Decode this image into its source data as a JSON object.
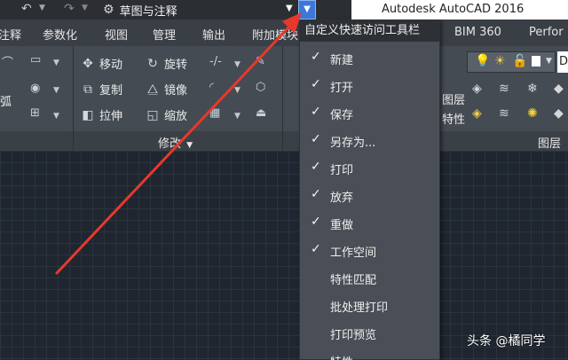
{
  "title_bar": {
    "workspace_name": "草图与注释",
    "app_title": "Autodesk AutoCAD 2016"
  },
  "ribbon_tabs": [
    "注释",
    "参数化",
    "视图",
    "管理",
    "输出",
    "附加模块",
    "BIM 360",
    "Perfor"
  ],
  "modify_panel": {
    "title": "修改",
    "buttons": {
      "move": "移动",
      "rotate": "旋转",
      "copy": "复制",
      "mirror": "镜像",
      "stretch": "拉伸",
      "scale": "缩放"
    }
  },
  "draw_panel": {
    "arc_label": "弧"
  },
  "layers_panel": {
    "title": "图层",
    "layer_props_top": "图层",
    "layer_props_bottom": "特性"
  },
  "right_edge_letter": "D",
  "qat_menu": {
    "header": "自定义快速访问工具栏",
    "items": [
      {
        "label": "新建",
        "checked": true
      },
      {
        "label": "打开",
        "checked": true
      },
      {
        "label": "保存",
        "checked": true
      },
      {
        "label": "另存为...",
        "checked": true
      },
      {
        "label": "打印",
        "checked": true
      },
      {
        "label": "放弃",
        "checked": true
      },
      {
        "label": "重做",
        "checked": true
      },
      {
        "label": "工作空间",
        "checked": true
      },
      {
        "label": "特性匹配",
        "checked": false
      },
      {
        "label": "批处理打印",
        "checked": false
      },
      {
        "label": "打印预览",
        "checked": false
      },
      {
        "label": "特性",
        "checked": false
      }
    ]
  },
  "watermark": "头条 @橘同学",
  "colors": {
    "annotation_arrow": "#e8382c",
    "qat_button": "#3b78d8",
    "menu_bg": "#4a4f57"
  }
}
